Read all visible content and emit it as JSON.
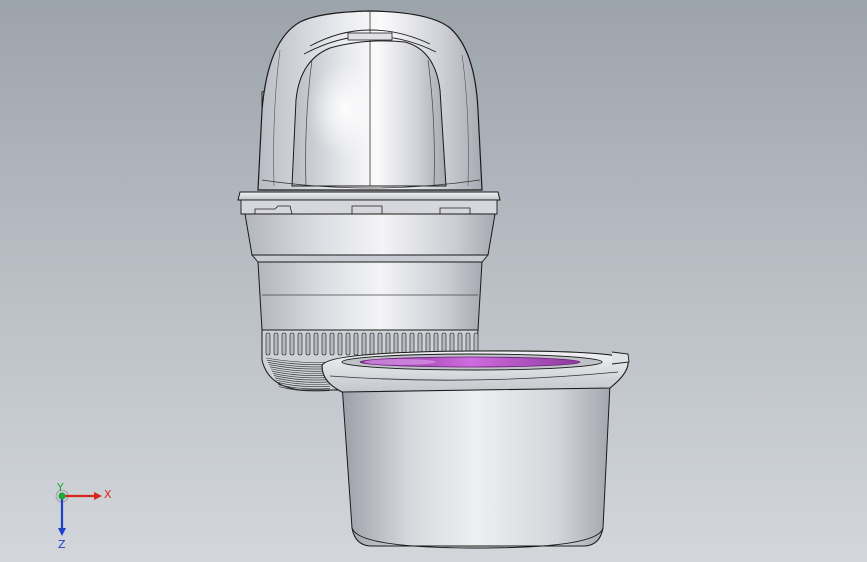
{
  "viewport": {
    "background_top": "#9ca3ab",
    "background_bottom": "#d3d7dc"
  },
  "triad": {
    "x_label": "X",
    "y_label": "Y",
    "z_label": "Z",
    "x_color": "#d6281e",
    "y_color": "#1fa83a",
    "z_color": "#1e3fc8"
  },
  "model": {
    "body_color": "#d9dbe0",
    "edge_color": "#1a1a1a",
    "accent_color": "#b447c8"
  }
}
